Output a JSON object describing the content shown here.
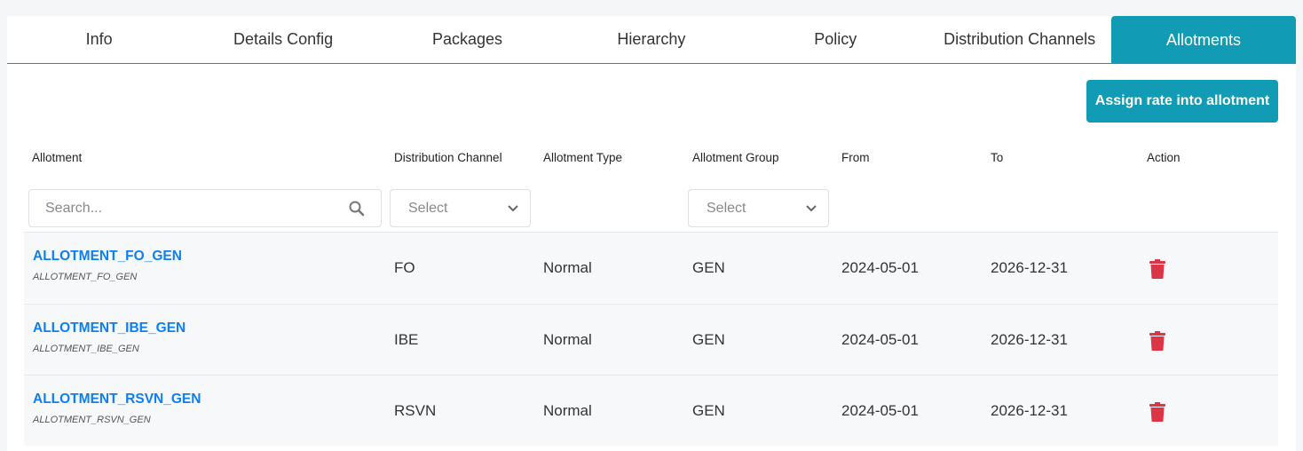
{
  "tabs": [
    "Info",
    "Details Config",
    "Packages",
    "Hierarchy",
    "Policy",
    "Distribution Channels",
    "Allotments"
  ],
  "active_tab": "Allotments",
  "assign_button": "Assign rate into allotment",
  "columns": [
    "Allotment",
    "Distribution Channel",
    "Allotment Type",
    "Allotment Group",
    "From",
    "To",
    "Action"
  ],
  "filters": {
    "search_placeholder": "Search...",
    "channel_select": "Select",
    "group_select": "Select"
  },
  "rows": [
    {
      "name": "ALLOTMENT_FO_GEN",
      "code": "ALLOTMENT_FO_GEN",
      "channel": "FO",
      "type": "Normal",
      "group": "GEN",
      "from": "2024-05-01",
      "to": "2026-12-31"
    },
    {
      "name": "ALLOTMENT_IBE_GEN",
      "code": "ALLOTMENT_IBE_GEN",
      "channel": "IBE",
      "type": "Normal",
      "group": "GEN",
      "from": "2024-05-01",
      "to": "2026-12-31"
    },
    {
      "name": "ALLOTMENT_RSVN_GEN",
      "code": "ALLOTMENT_RSVN_GEN",
      "channel": "RSVN",
      "type": "Normal",
      "group": "GEN",
      "from": "2024-05-01",
      "to": "2026-12-31"
    }
  ],
  "colors": {
    "accent": "#119bb5",
    "link": "#0d7ff0",
    "delete": "#dc3545"
  }
}
